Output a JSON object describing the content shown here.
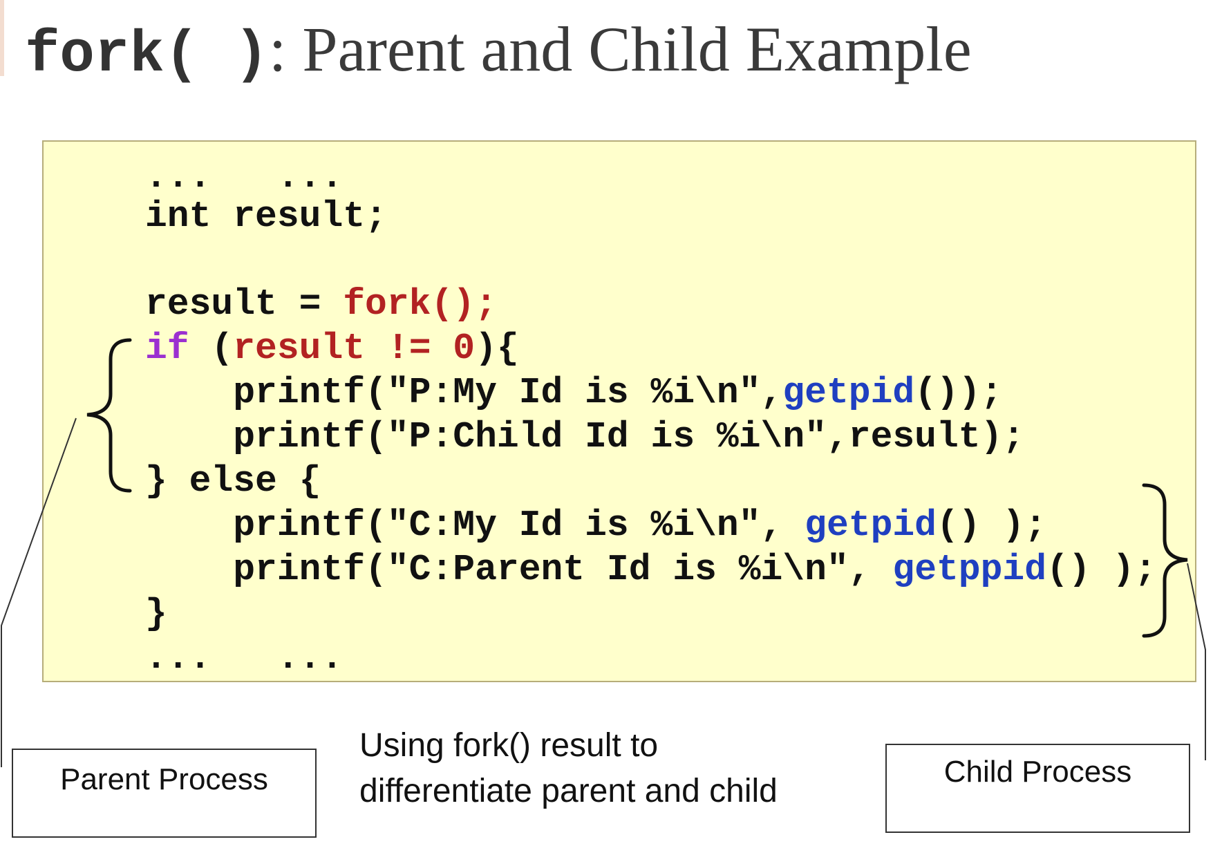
{
  "title": {
    "code": "fork( )",
    "text": ": Parent and Child Example"
  },
  "code": {
    "line1": "...   ...",
    "line2": "int result;",
    "line3_a": "result = ",
    "line3_b": "fork();",
    "line4_a": "if",
    "line4_b": " (",
    "line4_c": "result != 0",
    "line4_d": "){",
    "line5_a": "    printf(\"P:My Id is %i\\n\",",
    "line5_b": "getpid",
    "line5_c": "());",
    "line6": "    printf(\"P:Child Id is %i\\n\",result);",
    "line7": "} else {",
    "line8_a": "    printf(\"C:My Id is %i\\n\", ",
    "line8_b": "getpid",
    "line8_c": "() );",
    "line9_a": "    printf(\"C:Parent Id is %i\\n\", ",
    "line9_b": "getppid",
    "line9_c": "() );",
    "line10": "}",
    "line11": "...   ..."
  },
  "labels": {
    "parent": "Parent Process",
    "child": "Child Process",
    "caption_line1": "Using fork() result to",
    "caption_line2": "differentiate parent and child"
  },
  "colors": {
    "code_background": "#ffffcc",
    "keyword": "#9b30d0",
    "red_code": "#b22222",
    "function": "#1f3fc0"
  }
}
